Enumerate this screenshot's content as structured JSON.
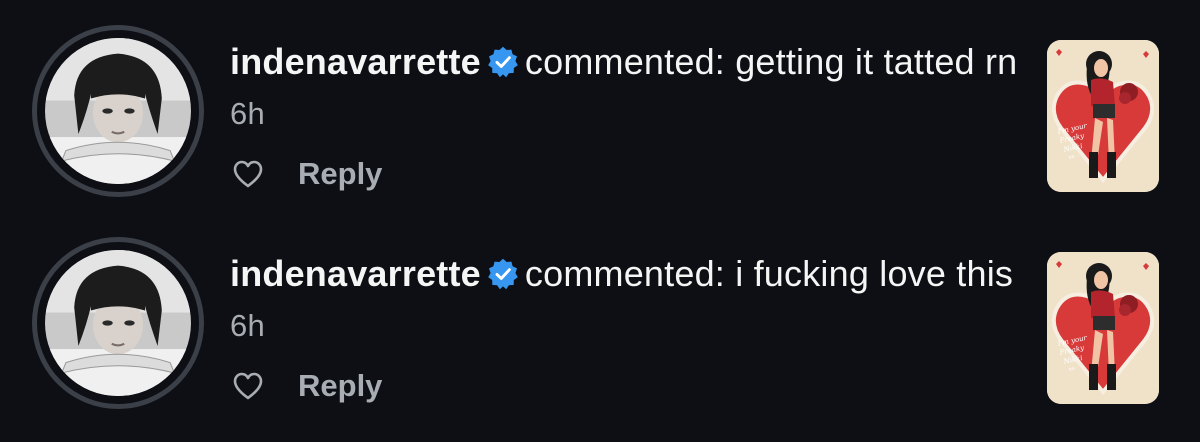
{
  "notifications": [
    {
      "username": "indenavarrette",
      "action_text": "commented: getting it tatted rn",
      "timestamp": "6h",
      "reply_label": "Reply",
      "verified_icon": "verified-badge-icon",
      "like_icon": "heart-outline-icon",
      "thumbnail_caption": "I'm your Freaky Nikki xo"
    },
    {
      "username": "indenavarrette",
      "action_text": "commented: i fucking love this",
      "timestamp": "6h",
      "reply_label": "Reply",
      "verified_icon": "verified-badge-icon",
      "like_icon": "heart-outline-icon",
      "thumbnail_caption": "I'm your Freaky Nikki xo"
    }
  ],
  "colors": {
    "background": "#0d0f14",
    "text_primary": "#f5f5f5",
    "text_secondary": "#a8acb3",
    "verified_blue": "#3797f0",
    "avatar_ring": "#3b3f47",
    "thumbnail_bg": "#efe2c9",
    "heart_red": "#d83a3a"
  }
}
